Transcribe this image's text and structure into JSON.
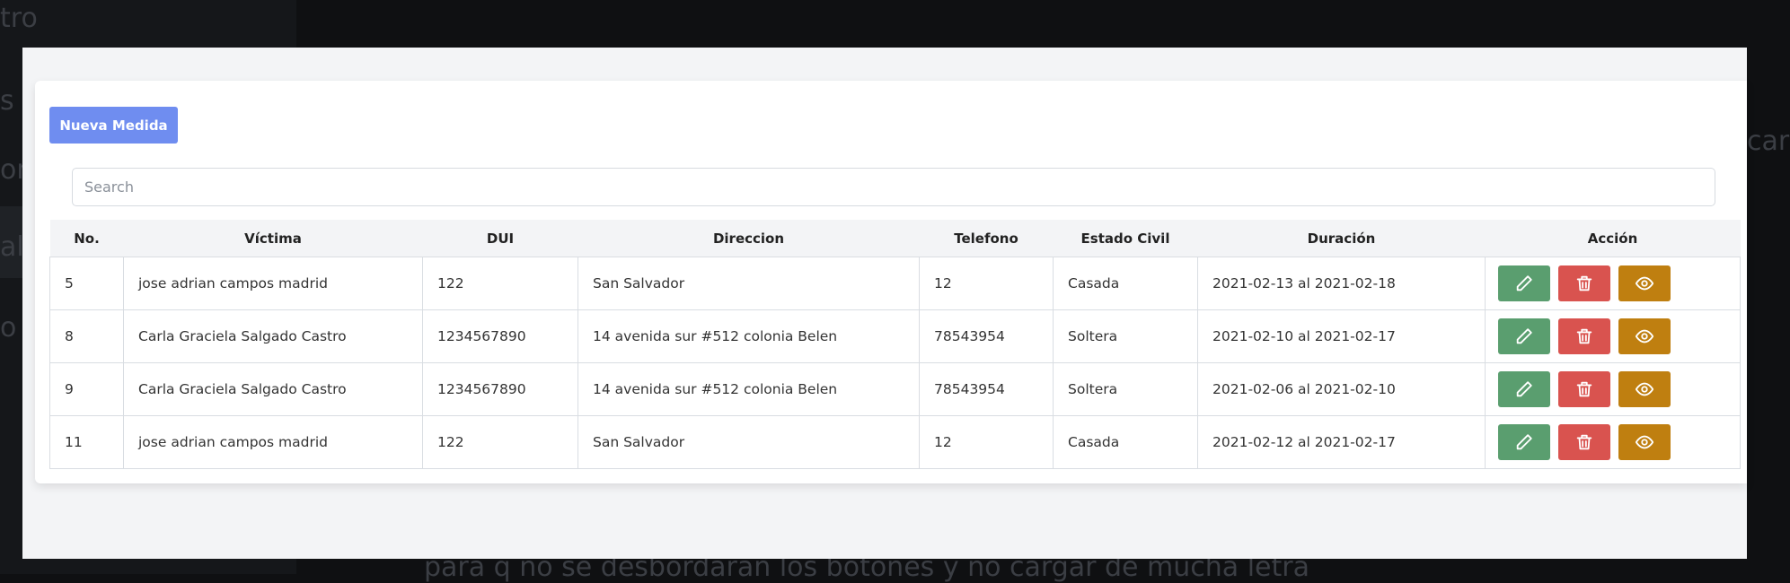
{
  "background": {
    "fragments": [
      "tro",
      "s",
      "om",
      "al",
      "o",
      "carg",
      "para q no se desbordaran los botones y no cargar de mucha letra"
    ]
  },
  "toolbar": {
    "new_label": "Nueva Medida"
  },
  "search": {
    "placeholder": "Search"
  },
  "table": {
    "headers": [
      "No.",
      "Víctima",
      "DUI",
      "Direccion",
      "Telefono",
      "Estado Civil",
      "Duración",
      "Acción"
    ],
    "rows": [
      {
        "no": "5",
        "victima": "jose adrian campos madrid",
        "dui": "122",
        "direccion": "San Salvador",
        "telefono": "12",
        "estado": "Casada",
        "duracion": "2021-02-13 al 2021-02-18"
      },
      {
        "no": "8",
        "victima": "Carla Graciela Salgado Castro",
        "dui": "1234567890",
        "direccion": "14 avenida sur #512 colonia Belen",
        "telefono": "78543954",
        "estado": "Soltera",
        "duracion": "2021-02-10 al 2021-02-17"
      },
      {
        "no": "9",
        "victima": "Carla Graciela Salgado Castro",
        "dui": "1234567890",
        "direccion": "14 avenida sur #512 colonia Belen",
        "telefono": "78543954",
        "estado": "Soltera",
        "duracion": "2021-02-06 al 2021-02-10"
      },
      {
        "no": "11",
        "victima": "jose adrian campos madrid",
        "dui": "122",
        "direccion": "San Salvador",
        "telefono": "12",
        "estado": "Casada",
        "duracion": "2021-02-12 al 2021-02-17"
      }
    ]
  },
  "actions": {
    "edit_icon": "pencil-icon",
    "delete_icon": "trash-icon",
    "view_icon": "eye-icon"
  },
  "colors": {
    "primary": "#6f8df0",
    "edit": "#5a9e6f",
    "delete": "#d9534f",
    "view": "#bf7f10"
  }
}
